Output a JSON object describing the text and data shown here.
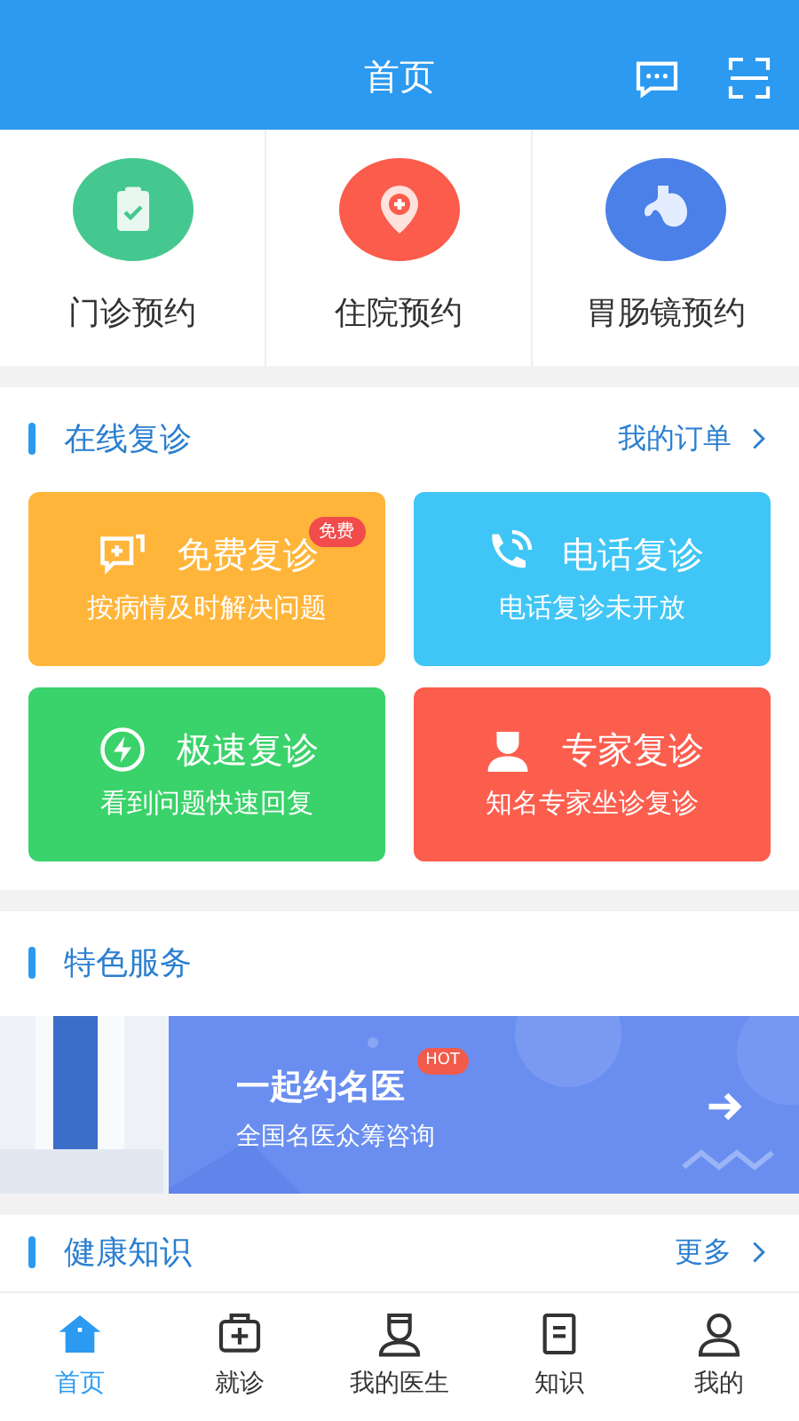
{
  "header": {
    "title": "首页"
  },
  "quick_entries": [
    {
      "kind": "clipboard",
      "label": "门诊预约",
      "color": "#45c88f"
    },
    {
      "kind": "pin",
      "label": "住院预约",
      "color": "#fb5c4c"
    },
    {
      "kind": "stomach",
      "label": "胃肠镜预约",
      "color": "#4a80e8"
    }
  ],
  "online_revisit": {
    "title": "在线复诊",
    "link": "我的订单",
    "cards": [
      {
        "kind": "chat",
        "title": "免费复诊",
        "badge": "免费",
        "subtitle": "按病情及时解决问题",
        "color": "#ffb53a"
      },
      {
        "kind": "phone",
        "title": "电话复诊",
        "subtitle": "电话复诊未开放",
        "color": "#40c6f6"
      },
      {
        "kind": "bolt",
        "title": "极速复诊",
        "subtitle": "看到问题快速回复",
        "color": "#3ad26a"
      },
      {
        "kind": "doctor",
        "title": "专家复诊",
        "subtitle": "知名专家坐诊复诊",
        "color": "#fc5e4e"
      }
    ]
  },
  "featured": {
    "title": "特色服务",
    "banner": {
      "title": "一起约名医",
      "badge": "HOT",
      "subtitle": "全国名医众筹咨询"
    }
  },
  "health": {
    "title": "健康知识",
    "link": "更多"
  },
  "tabbar": [
    {
      "kind": "home",
      "label": "首页",
      "selected": true
    },
    {
      "kind": "kit",
      "label": "就诊",
      "selected": false
    },
    {
      "kind": "doctor",
      "label": "我的医生",
      "selected": false
    },
    {
      "kind": "doc",
      "label": "知识",
      "selected": false
    },
    {
      "kind": "user",
      "label": "我的",
      "selected": false
    }
  ]
}
